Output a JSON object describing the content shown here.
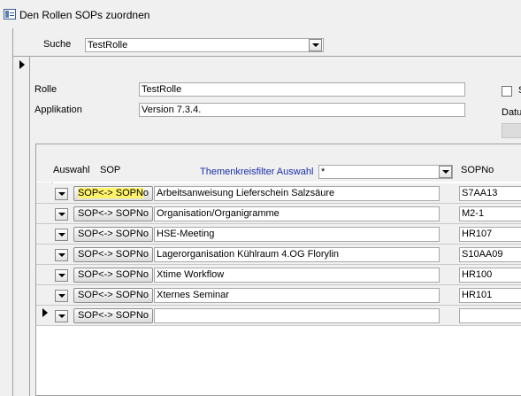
{
  "window": {
    "title": "Den Rollen SOPs zuordnen"
  },
  "header": {
    "search_label": "Suche",
    "search_value": "TestRolle"
  },
  "fields": {
    "rolle_label": "Rolle",
    "rolle_value": "TestRolle",
    "applikation_label": "Applikation",
    "applikation_value": "Version 7.3.4.",
    "checkbox_label_partial": "S",
    "datum_label_partial": "Datu"
  },
  "subform": {
    "col_auswahl": "Auswahl",
    "col_sop": "SOP",
    "filter_label": "Themenkreisfilter Auswahl",
    "filter_value": "*",
    "col_sopno": "SOPNo",
    "button_label": "SOP<-> SOPNo",
    "button_label_hl_part": "SOP<-> SOPN",
    "button_label_rest_part": "o",
    "rows": [
      {
        "title": "Arbeitsanweisung Lieferschein Salzsäure",
        "sopno": "S7AA13"
      },
      {
        "title": "Organisation/Organigramme",
        "sopno": "M2-1"
      },
      {
        "title": "HSE-Meeting",
        "sopno": "HR107"
      },
      {
        "title": "Lagerorganisation Kühlraum 4.OG Florylin",
        "sopno": "S10AA09"
      },
      {
        "title": "Xtime Workflow",
        "sopno": "HR100"
      },
      {
        "title": "Xternes Seminar",
        "sopno": "HR101"
      },
      {
        "title": "",
        "sopno": ""
      }
    ]
  }
}
